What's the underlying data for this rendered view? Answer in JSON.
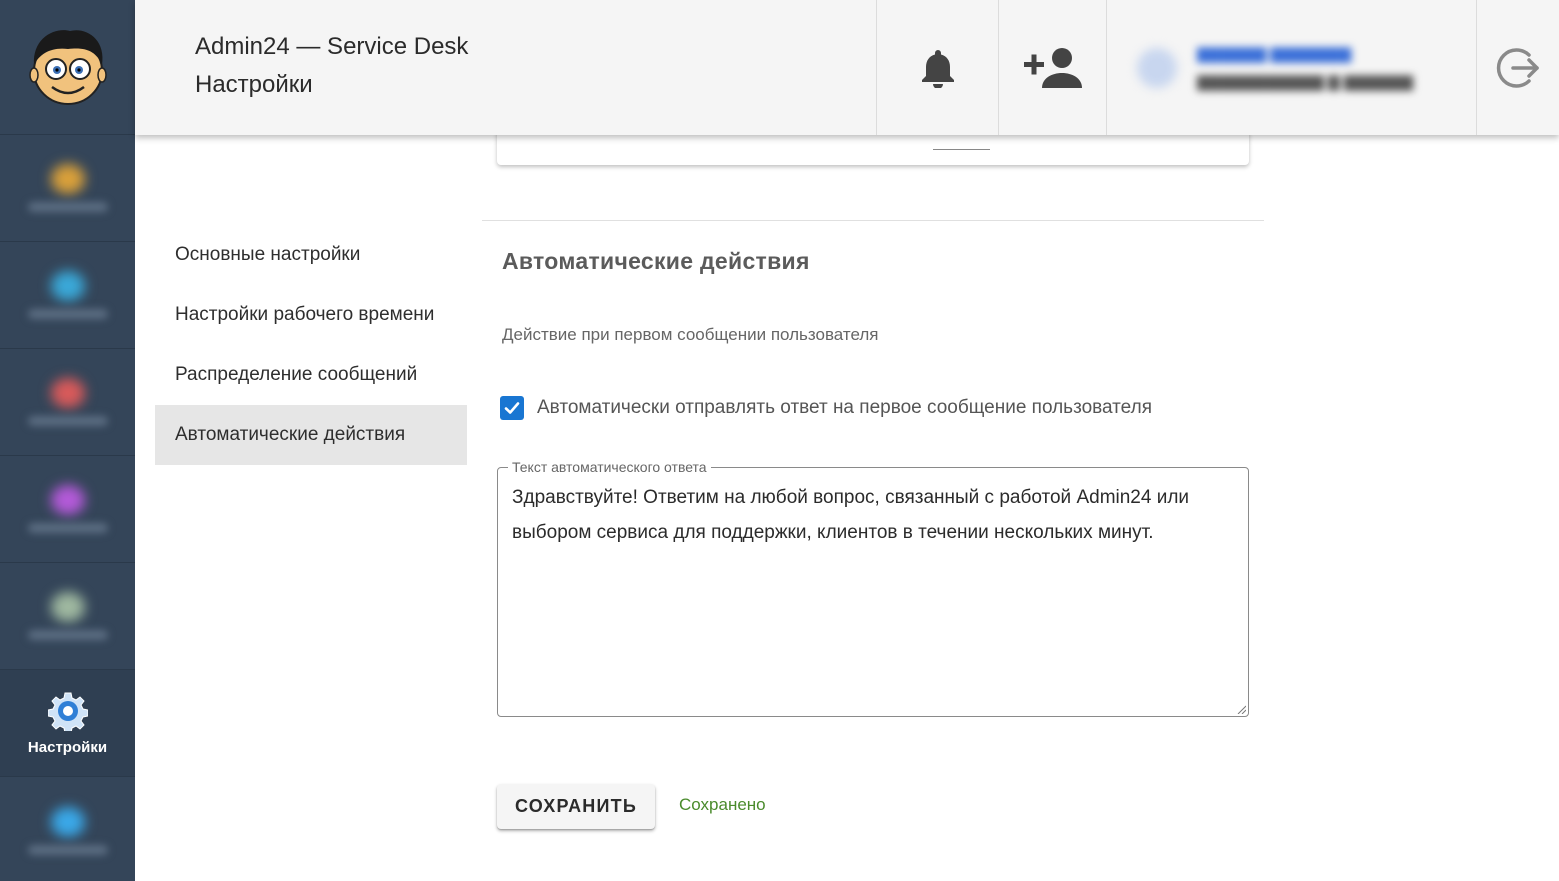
{
  "header": {
    "app_title": "Admin24 — Service Desk",
    "page_title": "Настройки"
  },
  "sidebar": {
    "active_item": {
      "label": "Настройки",
      "icon": "gear-icon"
    },
    "blurred_item_colors": [
      "#d9a03a",
      "#3aa8d8",
      "#d85a5a",
      "#b35ad8",
      "#9fb8a0",
      "#3aa8e8"
    ]
  },
  "settings_nav": {
    "items": [
      {
        "label": "Основные настройки"
      },
      {
        "label": "Настройки рабочего времени"
      },
      {
        "label": "Распределение сообщений"
      },
      {
        "label": "Автоматические действия"
      }
    ]
  },
  "section": {
    "title": "Автоматические действия",
    "subsection": "Действие при первом сообщении пользователя",
    "checkbox": {
      "checked": true,
      "label": "Автоматически отправлять ответ на первое сообщение пользователя"
    },
    "reply_field": {
      "label": "Текст автоматического ответа",
      "value": "Здравствуйте! Ответим на любой вопрос, связанный с работой Admin24 или выбором сервиса для поддержки, клиентов в течении нескольких минут."
    },
    "save_label": "СОХРАНИТЬ",
    "save_status": "Сохранено"
  },
  "colors": {
    "sidebar_bg": "#344559",
    "accent": "#1976d2",
    "success": "#4a8b2c"
  }
}
